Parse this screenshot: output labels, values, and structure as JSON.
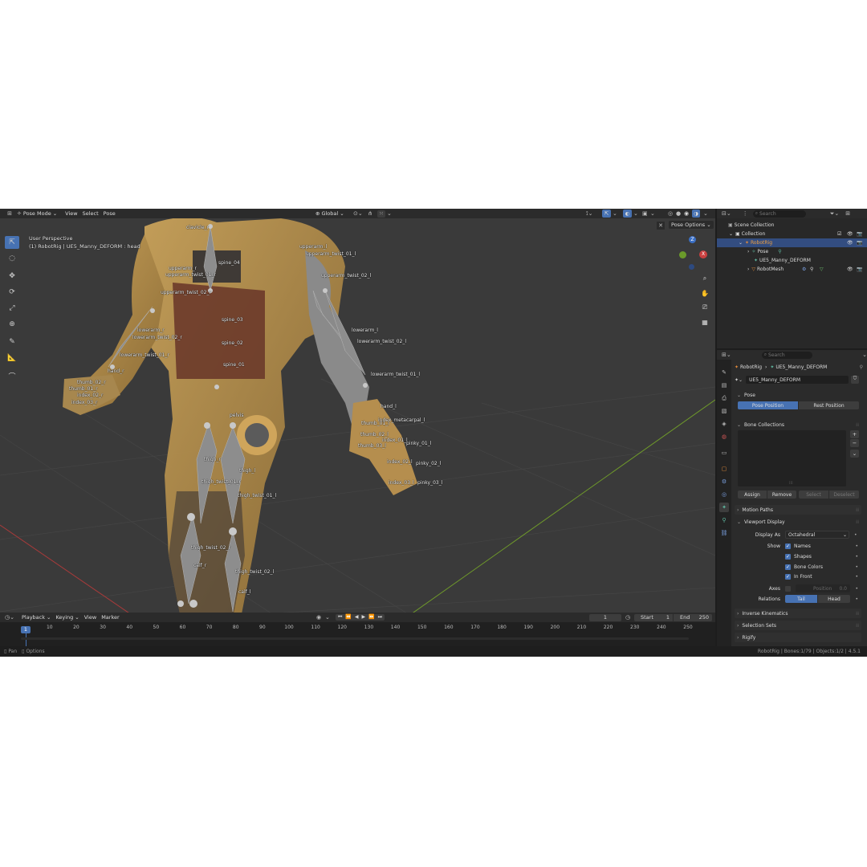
{
  "viewport_header": {
    "mode": "Pose Mode",
    "menus": [
      "View",
      "Select",
      "Pose"
    ],
    "orientation": "Global",
    "pose_options": "Pose Options"
  },
  "viewport_info": {
    "perspective": "User Perspective",
    "context": "(1) RobotRig | UE5_Manny_DEFORM : head"
  },
  "bone_labels": [
    "clavicle_r",
    "upperarm_r",
    "upperarm_twist_01_r",
    "upperarm_twist_02_r",
    "spine_04",
    "spine_03",
    "spine_02",
    "spine_01",
    "lowerarm_r",
    "lowerarm_twist_02_r",
    "lowerarm_twist_01_r",
    "hand_r",
    "thumb_02_r",
    "thumb_01_r",
    "index_02_r",
    "index_03_r",
    "upperarm_l",
    "upperarm_twist_01_l",
    "upperarm_twist_02_l",
    "lowerarm_l",
    "lowerarm_twist_02_l",
    "lowerarm_twist_01_l",
    "hand_l",
    "thumb_01_l",
    "thumb_02_l",
    "thumb_03_l",
    "index_metacarpal_l",
    "index_01_l",
    "index_02_l",
    "index_03_l",
    "pinky_01_l",
    "pinky_02_l",
    "pinky_03_l",
    "pelvis",
    "thigh_r",
    "thigh_l",
    "thigh_twist_01_r",
    "thigh_twist_01_l",
    "thigh_twist_02_r",
    "thigh_twist_02_l",
    "calf_r",
    "calf_l"
  ],
  "outliner": {
    "search_placeholder": "Search",
    "scene_collection": "Scene Collection",
    "collection": "Collection",
    "robot_rig": "RobotRig",
    "pose": "Pose",
    "armature": "UE5_Manny_DEFORM",
    "robot_mesh": "RobotMesh"
  },
  "properties": {
    "search_placeholder": "Search",
    "breadcrumb_object": "RobotRig",
    "breadcrumb_data": "UE5_Manny_DEFORM",
    "data_name": "UE5_Manny_DEFORM",
    "pose_panel": "Pose",
    "pose_position": "Pose Position",
    "rest_position": "Rest Position",
    "bone_collections": "Bone Collections",
    "assign": "Assign",
    "remove": "Remove",
    "select": "Select",
    "deselect": "Deselect",
    "motion_paths": "Motion Paths",
    "viewport_display": "Viewport Display",
    "display_as_label": "Display As",
    "display_as_value": "Octahedral",
    "show_label": "Show",
    "names": "Names",
    "shapes": "Shapes",
    "bone_colors": "Bone Colors",
    "in_front": "In Front",
    "axes_label": "Axes",
    "position_label": "Position",
    "position_value": "0.0",
    "relations_label": "Relations",
    "tail": "Tail",
    "head": "Head",
    "inverse_kinematics": "Inverse Kinematics",
    "selection_sets": "Selection Sets",
    "partial_panel": "Rigify"
  },
  "timeline": {
    "menus": [
      "Playback",
      "Keying",
      "View",
      "Marker"
    ],
    "current_frame": "1",
    "start_label": "Start",
    "start_value": "1",
    "end_label": "End",
    "end_value": "250",
    "ticks": [
      "1",
      "10",
      "20",
      "30",
      "40",
      "50",
      "60",
      "70",
      "80",
      "90",
      "100",
      "110",
      "120",
      "130",
      "140",
      "150",
      "160",
      "170",
      "180",
      "190",
      "200",
      "210",
      "220",
      "230",
      "240",
      "250"
    ]
  },
  "status": {
    "left1": "Pan",
    "left2": "Options",
    "right": "RobotRig | Bones:1/79 | Objects:1/2 | 4.5.1"
  },
  "colors": {
    "accent": "#4772b3",
    "selected_row": "#334d80",
    "grid_green": "#6f9a2a",
    "grid_red": "#a83a3a"
  }
}
